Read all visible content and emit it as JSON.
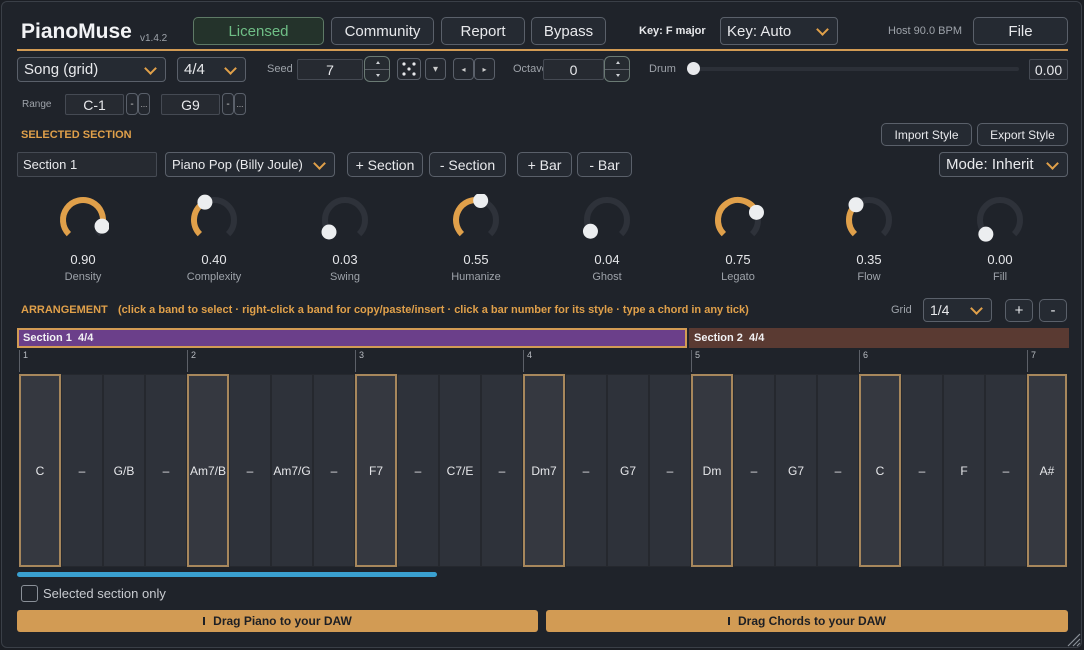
{
  "header": {
    "app_name": "PianoMuse",
    "version": "v1.4.2",
    "buttons": {
      "licensed": "Licensed",
      "community": "Community",
      "report": "Report",
      "bypass": "Bypass",
      "file": "File"
    },
    "key_readout": "Key: F major",
    "key_select": "Key: Auto",
    "host_bpm": "Host 90.0 BPM"
  },
  "controls": {
    "mode_select": "Song (grid)",
    "time_sig": "4/4",
    "seed_label": "Seed",
    "seed_value": "7",
    "octave_label": "Octave",
    "octave_value": "0",
    "drum_label": "Drum",
    "drum_value": "0.00",
    "drum_level": 0,
    "range_label": "Range",
    "range_low": "C-1",
    "range_high": "G9",
    "range_btn": "-",
    "range_more": "..."
  },
  "section": {
    "heading": "SELECTED SECTION",
    "import_style": "Import Style",
    "export_style": "Export Style",
    "name": "Section 1",
    "style": "Piano Pop (Billy Joule)",
    "add_section": "+ Section",
    "remove_section": "- Section",
    "add_bar": "+ Bar",
    "remove_bar": "- Bar",
    "mode": "Mode: Inherit"
  },
  "knobs": [
    {
      "name": "Density",
      "value": "0.90",
      "level": 0.9
    },
    {
      "name": "Complexity",
      "value": "0.40",
      "level": 0.4
    },
    {
      "name": "Swing",
      "value": "0.03",
      "level": 0.03
    },
    {
      "name": "Humanize",
      "value": "0.55",
      "level": 0.55
    },
    {
      "name": "Ghost",
      "value": "0.04",
      "level": 0.04
    },
    {
      "name": "Legato",
      "value": "0.75",
      "level": 0.75
    },
    {
      "name": "Flow",
      "value": "0.35",
      "level": 0.35
    },
    {
      "name": "Fill",
      "value": "0.00",
      "level": 0.0
    }
  ],
  "arrangement": {
    "heading": "ARRANGEMENT",
    "hint": "(click a band to select · right-click a band for copy/paste/insert · click a bar number for its style · type a chord in any tick)",
    "grid_label": "Grid",
    "grid_value": "1/4",
    "zoom_in": "+",
    "zoom_out": "-",
    "sections": [
      {
        "label": "Section 1  4/4"
      },
      {
        "label": "Section 2  4/4"
      }
    ],
    "bar_numbers": [
      "1",
      "2",
      "3",
      "4",
      "5",
      "6",
      "7"
    ],
    "ticks": [
      "C",
      "–",
      "G/B",
      "–",
      "Am7/B",
      "–",
      "Am7/G",
      "–",
      "F7",
      "–",
      "C7/E",
      "–",
      "Dm7",
      "–",
      "G7",
      "–",
      "Dm",
      "–",
      "G7",
      "–",
      "C",
      "–",
      "F",
      "–",
      "A#"
    ],
    "scroll_level": 0.4
  },
  "footer": {
    "selected_only": "Selected section only",
    "drag_piano": "Drag Piano to your DAW",
    "drag_chords": "Drag Chords to your DAW"
  },
  "colors": {
    "accent": "#e0a04a",
    "section1": "#6b3f8a",
    "section2": "#5a3a32",
    "scroll": "#3aa0d0",
    "knob_arc": "#e0a04a"
  }
}
